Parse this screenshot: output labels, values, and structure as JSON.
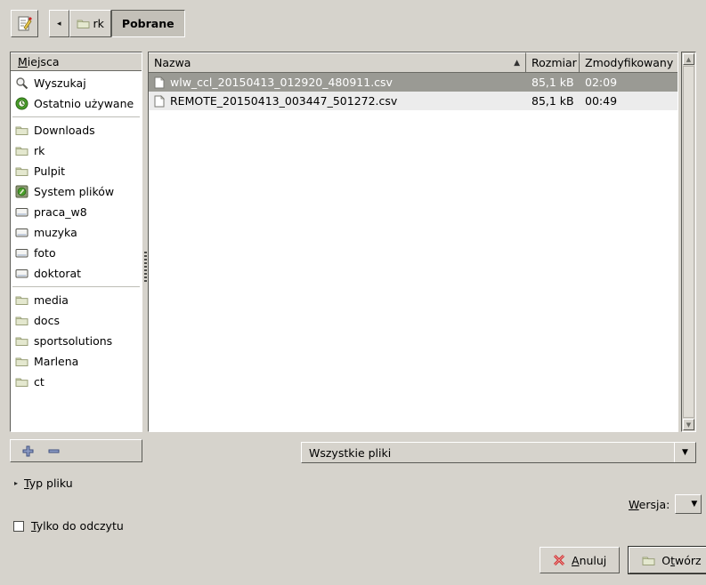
{
  "toolbar": {
    "edit_path_icon": "document-pencil-icon",
    "back_label": "◂",
    "crumbs": [
      {
        "label": "rk",
        "icon": "folder-icon",
        "active": false
      },
      {
        "label": "Pobrane",
        "icon": "",
        "active": true
      }
    ]
  },
  "sidebar": {
    "header": "Miejsca",
    "header_mnemonic": "M",
    "items": [
      {
        "label": "Wyszukaj",
        "icon": "search-icon"
      },
      {
        "label": "Ostatnio używane",
        "icon": "recent-icon"
      },
      {
        "separator": true
      },
      {
        "label": "Downloads",
        "icon": "folder-icon"
      },
      {
        "label": "rk",
        "icon": "folder-icon"
      },
      {
        "label": "Pulpit",
        "icon": "folder-icon"
      },
      {
        "label": "System plików",
        "icon": "harddisk-icon"
      },
      {
        "label": "praca_w8",
        "icon": "drive-icon"
      },
      {
        "label": "muzyka",
        "icon": "drive-icon"
      },
      {
        "label": "foto",
        "icon": "drive-icon"
      },
      {
        "label": "doktorat",
        "icon": "drive-icon"
      },
      {
        "separator": true
      },
      {
        "label": "media",
        "icon": "folder-icon"
      },
      {
        "label": "docs",
        "icon": "folder-icon"
      },
      {
        "label": "sportsolutions",
        "icon": "folder-icon"
      },
      {
        "label": "Marlena",
        "icon": "folder-icon"
      },
      {
        "label": "ct",
        "icon": "folder-icon"
      }
    ],
    "add_bookmark_icon": "plus-icon",
    "remove_bookmark_icon": "minus-icon"
  },
  "file_list": {
    "columns": [
      {
        "key": "name",
        "label": "Nazwa",
        "sorted": true,
        "sort_arrow": "▲"
      },
      {
        "key": "size",
        "label": "Rozmiar"
      },
      {
        "key": "modified",
        "label": "Zmodyfikowany"
      }
    ],
    "rows": [
      {
        "name": "wlw_ccl_20150413_012920_480911.csv",
        "size": "85,1 kB",
        "modified": "02:09",
        "icon": "file-icon",
        "selected": true
      },
      {
        "name": "REMOTE_20150413_003447_501272.csv",
        "size": "85,1 kB",
        "modified": "00:49",
        "icon": "file-icon",
        "selected": false
      }
    ]
  },
  "scrollbar": {
    "up_arrow": "▲",
    "down_arrow": "▼"
  },
  "filter": {
    "value": "Wszystkie pliki",
    "arrow": "▼"
  },
  "filetype_expander": {
    "label": "Typ pliku",
    "mnemonic": "T",
    "triangle": "▸",
    "expanded": false
  },
  "version": {
    "label": "Wersja:",
    "mnemonic": "W",
    "value": "",
    "arrow": "▼"
  },
  "readonly": {
    "label": "Tylko do odczytu",
    "mnemonic": "T",
    "checked": false
  },
  "actions": {
    "cancel": {
      "label": "Anuluj",
      "mnemonic": "A",
      "icon": "red-x-icon"
    },
    "open": {
      "label": "Otwórz",
      "mnemonic": "O",
      "icon": "folder-icon",
      "is_default": true
    }
  },
  "colors": {
    "window_bg": "#d6d3cc",
    "selection_bg": "#9a9a94",
    "row_alt_bg": "#ececec",
    "accent_red": "#cc2222",
    "folder_green": "#d5dbb4"
  }
}
